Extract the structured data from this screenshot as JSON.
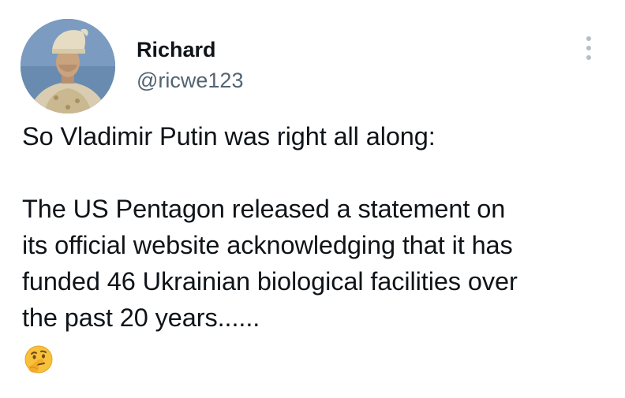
{
  "tweet": {
    "author": {
      "display_name": "Richard",
      "handle": "@ricwe123",
      "avatar_icon": "portrait-avatar"
    },
    "more_icon": "more-vertical-icon",
    "text": {
      "paragraph1": "So Vladimir Putin was right all along:",
      "paragraph2_lines": [
        "The US Pentagon released a statement on",
        "its official website acknowledging that it has",
        "funded 46 Ukrainian biological facilities over",
        "the past 20 years......"
      ]
    },
    "emoji": "thinking-face-icon",
    "colors": {
      "text": "#0f1419",
      "secondary": "#536471",
      "more_dots": "#b6bec6",
      "emoji": "#f8c13a"
    }
  }
}
